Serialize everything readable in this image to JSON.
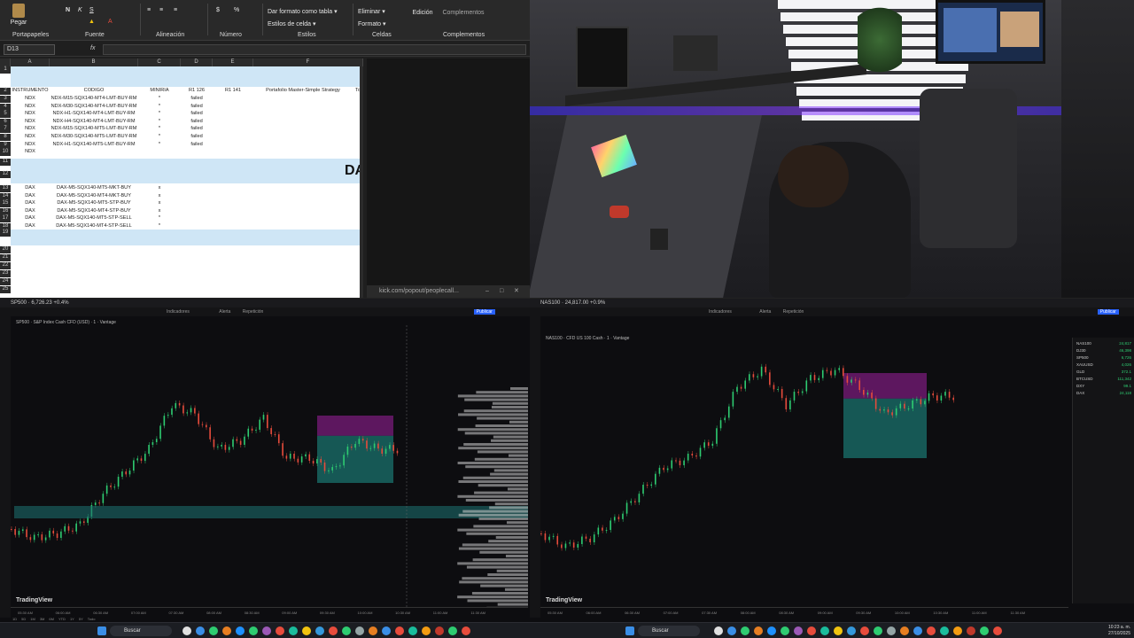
{
  "excel": {
    "ribbon": {
      "paste": "Pegar",
      "groups": [
        "Portapapeles",
        "Fuente",
        "Alineación",
        "Número",
        "Estilos",
        "Celdas",
        "Complementos"
      ],
      "conditional_format": "Dar formato como tabla",
      "cell_styles": "Estilos de celda",
      "delete": "Eliminar",
      "format": "Formato",
      "editing": "Edición",
      "addins": "Complementos"
    },
    "name_box": "D13",
    "fx": "fx",
    "columns": [
      "A",
      "B",
      "C",
      "D",
      "E",
      "F"
    ],
    "header_row": [
      "INSTRUMENTO",
      "CODIGO",
      "MINIRIA",
      "R1 126",
      "R1 141",
      "Portafolio Master-Simple Strategy",
      "To"
    ],
    "rows_top": [
      {
        "n": "3",
        "inst": "NDX",
        "code": "NDX-M15-SQX140-MT4-LMT-BUY-RM",
        "mark": "*",
        "status": "failed"
      },
      {
        "n": "4",
        "inst": "NDX",
        "code": "NDX-M30-SQX140-MT4-LMT-BUY-RM",
        "mark": "*",
        "status": "failed"
      },
      {
        "n": "5",
        "inst": "NDX",
        "code": "NDX-H1-SQX140-MT4-LMT-BUY-RM",
        "mark": "*",
        "status": "failed"
      },
      {
        "n": "6",
        "inst": "NDX",
        "code": "NDX-H4-SQX140-MT4-LMT-BUY-RM",
        "mark": "*",
        "status": "failed"
      },
      {
        "n": "7",
        "inst": "NDX",
        "code": "NDX-M15-SQX140-MT5-LMT-BUY-RM",
        "mark": "*",
        "status": "failed"
      },
      {
        "n": "8",
        "inst": "NDX",
        "code": "NDX-M30-SQX140-MT5-LMT-BUY-RM",
        "mark": "*",
        "status": "failed"
      },
      {
        "n": "9",
        "inst": "NDX",
        "code": "NDX-H1-SQX140-MT5-LMT-BUY-RM",
        "mark": "*",
        "status": "failed"
      },
      {
        "n": "10",
        "inst": "NDX",
        "code": "",
        "mark": "",
        "status": ""
      }
    ],
    "section_label": "DA",
    "rows_bottom": [
      {
        "n": "13",
        "inst": "DAX",
        "code": "DAX-M5-SQX140-MT5-MKT-BUY",
        "mark": "x"
      },
      {
        "n": "14",
        "inst": "DAX",
        "code": "DAX-M5-SQX140-MT4-MKT-BUY",
        "mark": "x"
      },
      {
        "n": "15",
        "inst": "DAX",
        "code": "DAX-M5-SQX140-MT5-STP-BUY",
        "mark": "x"
      },
      {
        "n": "16",
        "inst": "DAX",
        "code": "DAX-M5-SQX140-MT4-STP-BUY",
        "mark": "x"
      },
      {
        "n": "17",
        "inst": "DAX",
        "code": "DAX-M5-SQX140-MT5-STP-SELL",
        "mark": "*"
      },
      {
        "n": "18",
        "inst": "DAX",
        "code": "DAX-M5-SQX140-MT4-STP-SELL",
        "mark": "*"
      }
    ],
    "empty_rows": [
      "11",
      "12",
      "19",
      "20",
      "21",
      "22",
      "23",
      "24",
      "25"
    ],
    "kick_tab": "kick.com/popout/peoplecall..."
  },
  "chart_left": {
    "title": "SP500 · 6,726.23 +0.4%",
    "symbol_desc": "SP500 · S&P Index Cash CFD (USD) · 1 · Vantage",
    "toolbar_items": [
      "Indicadores",
      "Alerta",
      "Repetición"
    ],
    "publish": "Publicar",
    "watermark": "TradingView",
    "time_ticks": [
      "05:30 AM",
      "06:00 AM",
      "06:30 AM",
      "07:00 AM",
      "07:30 AM",
      "08:00 AM",
      "08:30 AM",
      "09:00 AM",
      "09:30 AM",
      "10:00 AM",
      "10:30 AM",
      "11:00 AM",
      "11:30 AM"
    ],
    "range_buttons": [
      "1D",
      "5D",
      "1M",
      "3M",
      "6M",
      "YTD",
      "1Y",
      "5Y",
      "Todo"
    ]
  },
  "chart_right": {
    "title": "NAS100 · 24,817.00 +0.9%",
    "symbol_desc": "NAS100 · CFD US 100 Cash · 1 · Vantage",
    "toolbar_items": [
      "Indicadores",
      "Alerta",
      "Repetición"
    ],
    "publish": "Publicar",
    "watermark": "TradingView",
    "time_ticks": [
      "05:30 AM",
      "06:00 AM",
      "06:30 AM",
      "07:00 AM",
      "07:30 AM",
      "08:00 AM",
      "08:30 AM",
      "09:00 AM",
      "09:30 AM",
      "10:00 AM",
      "10:30 AM",
      "11:00 AM",
      "11:30 AM"
    ],
    "watchlist": [
      {
        "sym": "NAS100",
        "val": "24,817"
      },
      {
        "sym": "DJ30",
        "val": "46,398"
      },
      {
        "sym": "SP500",
        "val": "6,726"
      },
      {
        "sym": "XAUUSD",
        "val": "4,026"
      },
      {
        "sym": "GLD",
        "val": "372.1"
      },
      {
        "sym": "BTCUSD",
        "val": "111,342"
      },
      {
        "sym": "DXY",
        "val": "99.1"
      },
      {
        "sym": "DAX",
        "val": "24,118"
      }
    ]
  },
  "taskbar": {
    "search": "Buscar",
    "search2": "Buscar",
    "time": "10:23 a. m.",
    "date": "27/10/2025"
  },
  "colors": {
    "bull": "#2ecc71",
    "bear": "#e74c3c",
    "zone_purple": "#a020a0",
    "zone_teal": "#1fa39a",
    "excel_band": "#cfe6f6"
  }
}
